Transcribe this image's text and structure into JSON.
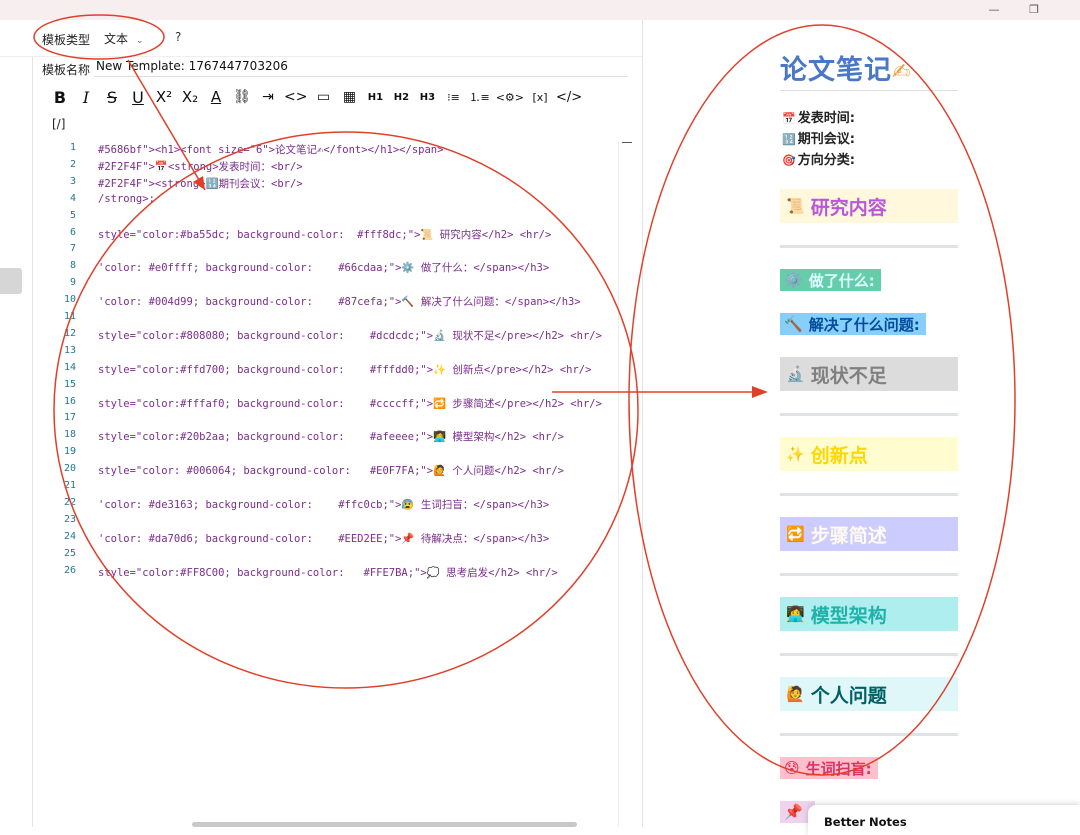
{
  "window": {
    "min": "—",
    "restore": "❐"
  },
  "template": {
    "type_label": "模板类型",
    "type_value": "文本",
    "help": "?",
    "name_label": "模板名称",
    "name_value": "New Template: 1767447703206"
  },
  "toolbar": {
    "bold": "B",
    "italic": "I",
    "strike": "S",
    "underline": "U",
    "sup": "X²",
    "sub": "X₂",
    "color": "A",
    "link": "⛓",
    "list_tab": "⇥",
    "code": "<>",
    "hr": "▭",
    "table": "▦",
    "h1": "H1",
    "h2": "H2",
    "h3": "H3",
    "ul": "⁝≡",
    "ol": "⒈≡",
    "embed": "<⚙>",
    "formula": "[x]",
    "html": "</>"
  },
  "editor": {
    "source_toggle": "[/]",
    "lines": [
      {
        "n": "1",
        "t": "#5686bf\"><h1><font size=\"6\">论文笔记✍</font></h1></span>"
      },
      {
        "n": "2",
        "t": "#2F2F4F\">📅<strong>发表时间：<br/>"
      },
      {
        "n": "3",
        "t": "#2F2F4F\"><strong>🔢期刊会议：<br/>"
      },
      {
        "n": "4",
        "t": "/strong>:"
      },
      {
        "n": "5",
        "t": ""
      },
      {
        "n": "6",
        "t": "style=\"color:#ba55dc; background-color:  #fff8dc;\">📜 研究内容</h2> <hr/>"
      },
      {
        "n": "7",
        "t": ""
      },
      {
        "n": "8",
        "t": "'color: #e0ffff; background-color:    #66cdaa;\">⚙️ 做了什么：</span></h3>"
      },
      {
        "n": "9",
        "t": ""
      },
      {
        "n": "10",
        "t": "'color: #004d99; background-color:    #87cefa;\">🔨 解决了什么问题：</span></h3>"
      },
      {
        "n": "11",
        "t": ""
      },
      {
        "n": "12",
        "t": "style=\"color:#808080; background-color:    #dcdcdc;\">🔬 现状不足</pre></h2> <hr/>"
      },
      {
        "n": "13",
        "t": ""
      },
      {
        "n": "14",
        "t": "style=\"color:#ffd700; background-color:    #fffdd0;\">✨ 创新点</pre></h2> <hr/>"
      },
      {
        "n": "15",
        "t": ""
      },
      {
        "n": "16",
        "t": "style=\"color:#fffaf0; background-color:    #ccccff;\">🔁 步骤简述</pre></h2> <hr/>"
      },
      {
        "n": "17",
        "t": ""
      },
      {
        "n": "18",
        "t": "style=\"color:#20b2aa; background-color:    #afeeee;\">👩‍💻 模型架构</h2> <hr/>"
      },
      {
        "n": "19",
        "t": ""
      },
      {
        "n": "20",
        "t": "style=\"color: #006064; background-color:   #E0F7FA;\">🙋 个人问题</h2> <hr/>"
      },
      {
        "n": "21",
        "t": ""
      },
      {
        "n": "22",
        "t": "'color: #de3163; background-color:    #ffc0cb;\">😰 生词扫盲：</span></h3>"
      },
      {
        "n": "23",
        "t": ""
      },
      {
        "n": "24",
        "t": "'color: #da70d6; background-color:    #EED2EE;\">📌 待解决点：</span></h3>"
      },
      {
        "n": "25",
        "t": ""
      },
      {
        "n": "26",
        "t": "style=\"color:#FF8C00; background-color:   #FFE7BA;\">💭 思考启发</h2> <hr/>"
      }
    ]
  },
  "preview": {
    "title": "论文笔记",
    "title_emoji": "✍",
    "meta": [
      {
        "emoji": "📅",
        "text": "发表时间:"
      },
      {
        "emoji": "🔢",
        "text": "期刊会议:"
      },
      {
        "emoji": "🎯",
        "text": "方向分类:"
      }
    ],
    "sections": [
      {
        "emoji": "📜",
        "text": "研究内容",
        "kind": "h2",
        "color": "#ba55dc",
        "bg": "#fff8dc"
      },
      {
        "emoji": "⚙️",
        "text": "做了什么:",
        "kind": "h3",
        "color": "#e0ffff",
        "bg": "#66cdaa"
      },
      {
        "emoji": "🔨",
        "text": "解决了什么问题:",
        "kind": "h3",
        "color": "#004d99",
        "bg": "#87cefa"
      },
      {
        "emoji": "🔬",
        "text": "现状不足",
        "kind": "h2",
        "color": "#808080",
        "bg": "#dcdcdc"
      },
      {
        "emoji": "✨",
        "text": "创新点",
        "kind": "h2",
        "color": "#ffd700",
        "bg": "#fffdd0"
      },
      {
        "emoji": "🔁",
        "text": "步骤简述",
        "kind": "h2",
        "color": "#fffaf0",
        "bg": "#ccccff"
      },
      {
        "emoji": "👩‍💻",
        "text": "模型架构",
        "kind": "h2",
        "color": "#20b2aa",
        "bg": "#afeeee"
      },
      {
        "emoji": "🙋",
        "text": "个人问题",
        "kind": "h2",
        "color": "#006064",
        "bg": "#E0F7FA"
      },
      {
        "emoji": "😰",
        "text": "生词扫盲:",
        "kind": "h3",
        "color": "#de3163",
        "bg": "#ffc0cb"
      },
      {
        "emoji": "📌",
        "text": "",
        "kind": "h3",
        "color": "#da70d6",
        "bg": "#EED2EE"
      }
    ]
  },
  "toast": {
    "text": "Better Notes"
  },
  "colors": {
    "annotation": "#e0402a",
    "line_number": "#237893",
    "code_text": "#7a2d8c",
    "title_blue": "#4a78c8"
  }
}
